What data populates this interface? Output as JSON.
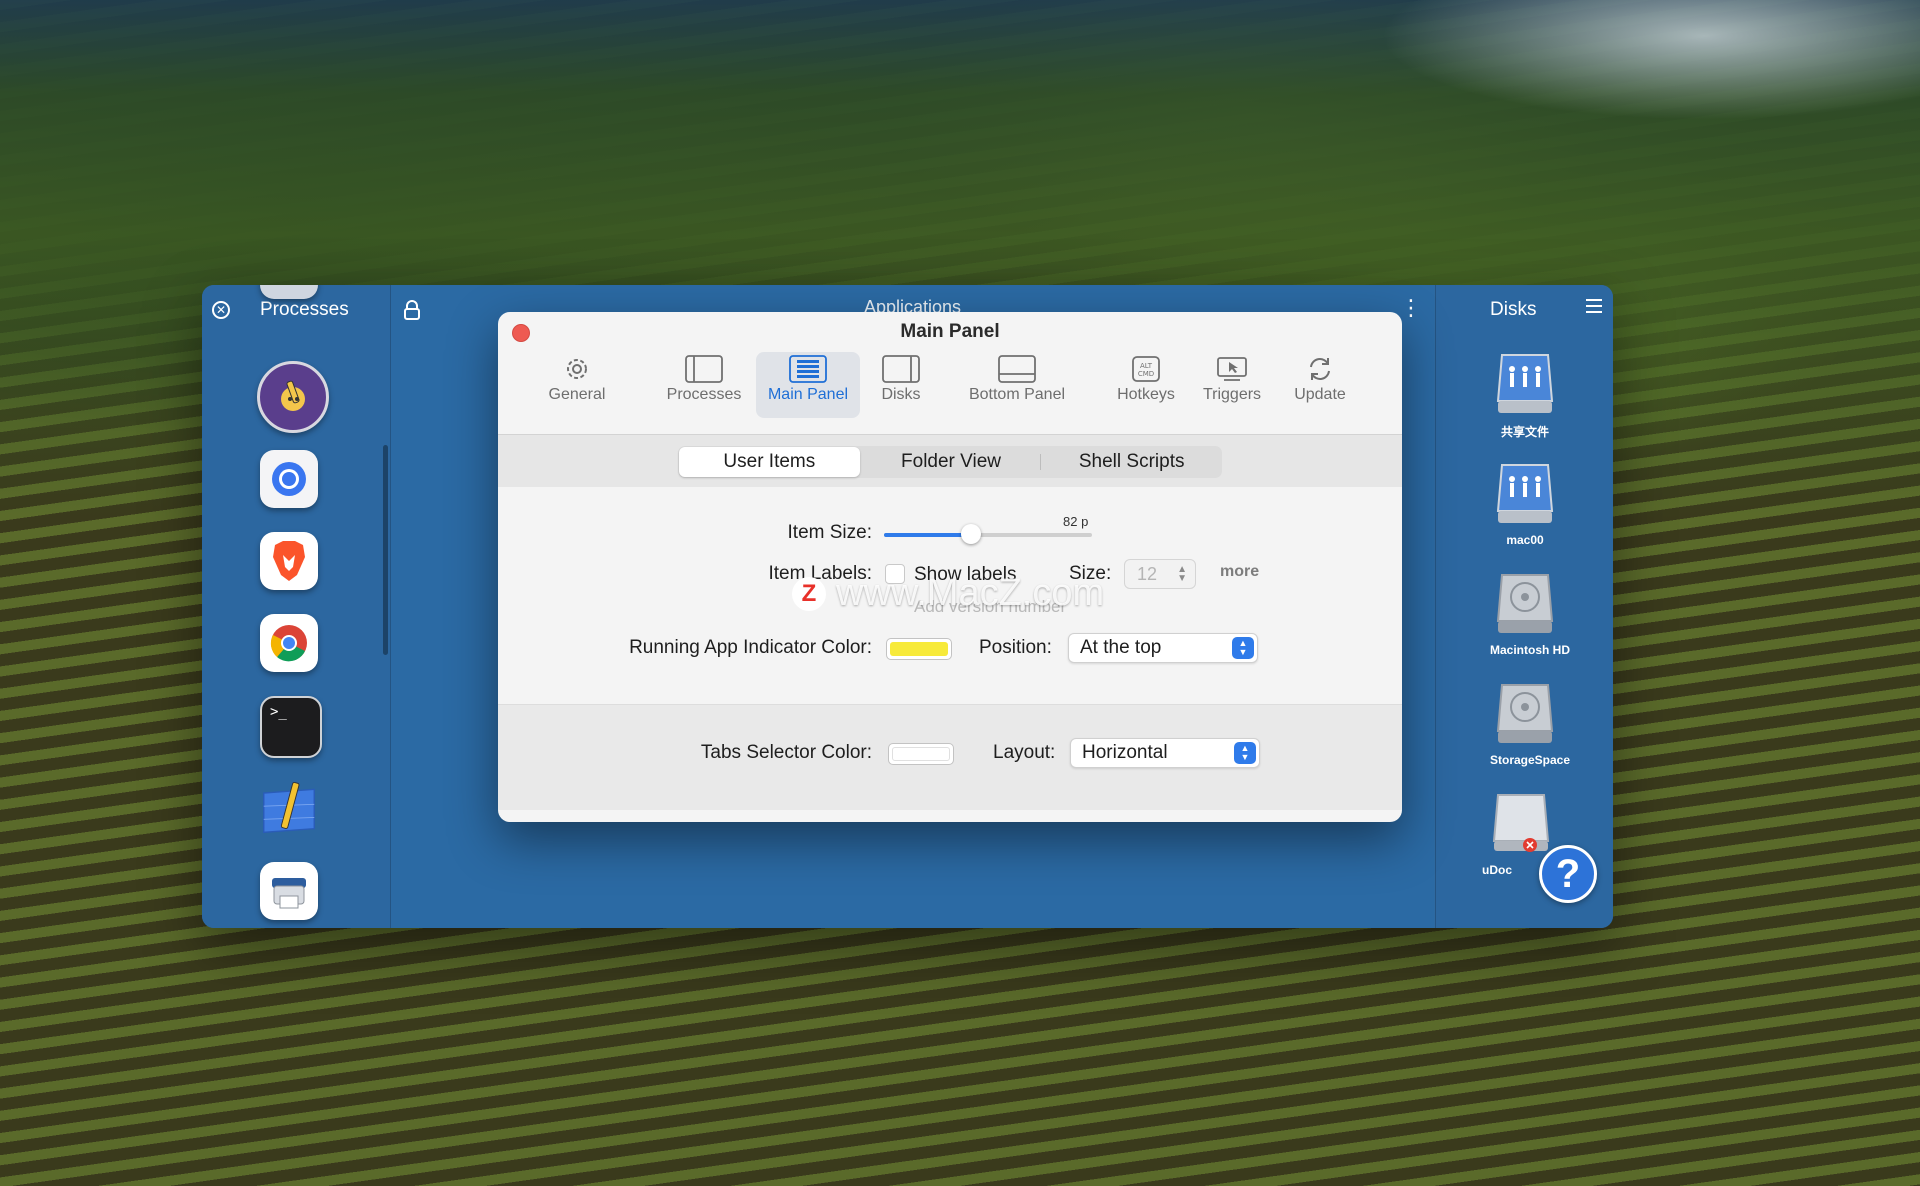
{
  "columns": {
    "processes_title": "Processes",
    "apps_title": "Applications",
    "disks_title": "Disks"
  },
  "dock_icons": [
    "folder-partial-icon",
    "pencil-app-icon",
    "signal-app-icon",
    "brave-browser-icon",
    "chrome-browser-icon",
    "terminal-app-icon",
    "blueprint-app-icon",
    "printer-app-icon"
  ],
  "disks": [
    {
      "label": "共享文件",
      "icon": "network-share-icon"
    },
    {
      "label": "mac00",
      "icon": "network-share-icon"
    },
    {
      "label": "Macintosh HD",
      "icon": "hard-drive-icon"
    },
    {
      "label": "StorageSpace",
      "icon": "hard-drive-icon"
    },
    {
      "label": "uDoc",
      "icon": "external-drive-icon"
    }
  ],
  "dialog": {
    "title": "Main Panel",
    "toolbar": [
      {
        "label": "General",
        "icon": "gear-icon"
      },
      {
        "label": "Processes",
        "icon": "sidebar-left-icon"
      },
      {
        "label": "Main Panel",
        "icon": "grid-panel-icon",
        "active": true
      },
      {
        "label": "Disks",
        "icon": "sidebar-right-icon"
      },
      {
        "label": "Bottom Panel",
        "icon": "bottom-panel-icon"
      },
      {
        "label": "Hotkeys",
        "icon": "alt-cmd-key-icon"
      },
      {
        "label": "Triggers",
        "icon": "cursor-screen-icon"
      },
      {
        "label": "Update",
        "icon": "refresh-icon"
      }
    ],
    "tabs": [
      "User Items",
      "Folder View",
      "Shell Scripts"
    ],
    "active_tab": "User Items",
    "item_size_label": "Item Size:",
    "item_size_value": "82 p",
    "item_size_fraction": 0.42,
    "item_labels_label": "Item Labels:",
    "show_labels_label": "Show labels",
    "show_labels_checked": false,
    "size_label": "Size:",
    "size_value": "12",
    "more_label": "more",
    "add_version_label": "Add version number",
    "indicator_color_label": "Running App Indicator Color:",
    "indicator_color": "#f7ea3a",
    "position_label": "Position:",
    "position_value": "At the top",
    "tabs_selector_color_label": "Tabs Selector Color:",
    "tabs_selector_color": "#ffffff",
    "layout_label": "Layout:",
    "layout_value": "Horizontal"
  },
  "help_button": "?",
  "watermark": {
    "badge": "Z",
    "text": "www.MacZ.com"
  },
  "colors": {
    "panel_blue": "#2e6aa1",
    "accent": "#2f7bea",
    "close_red": "#ee5a52"
  }
}
